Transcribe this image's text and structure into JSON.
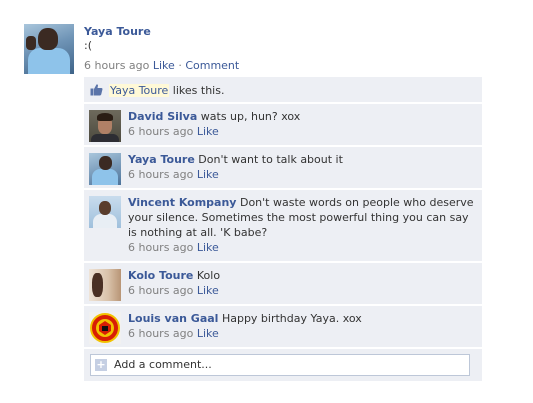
{
  "post": {
    "author": "Yaya Toure",
    "text": ":(",
    "time": "6 hours ago",
    "like_label": "Like",
    "separator": "·",
    "comment_label": "Comment"
  },
  "likes": {
    "liker": "Yaya Toure",
    "suffix": "likes this."
  },
  "comments": [
    {
      "name": "David Silva",
      "text": "wats up, hun? xox",
      "time": "6 hours ago",
      "like": "Like"
    },
    {
      "name": "Yaya Toure",
      "text": "Don't want to talk about it",
      "time": "6 hours ago",
      "like": "Like"
    },
    {
      "name": "Vincent Kompany",
      "text": "Don't waste words on people who deserve your silence. Sometimes the most powerful thing you can say is nothing at all. 'K babe?",
      "time": "6 hours ago",
      "like": "Like"
    },
    {
      "name": "Kolo Toure",
      "text": "Kolo",
      "time": "6 hours ago",
      "like": "Like"
    },
    {
      "name": "Louis van Gaal",
      "text": "Happy birthday Yaya. xox",
      "time": "6 hours ago",
      "like": "Like"
    }
  ],
  "add_comment": {
    "placeholder": "Add a comment..."
  },
  "colors": {
    "link": "#3b5998",
    "comment_bg": "#edeff4",
    "meta": "#808080"
  }
}
